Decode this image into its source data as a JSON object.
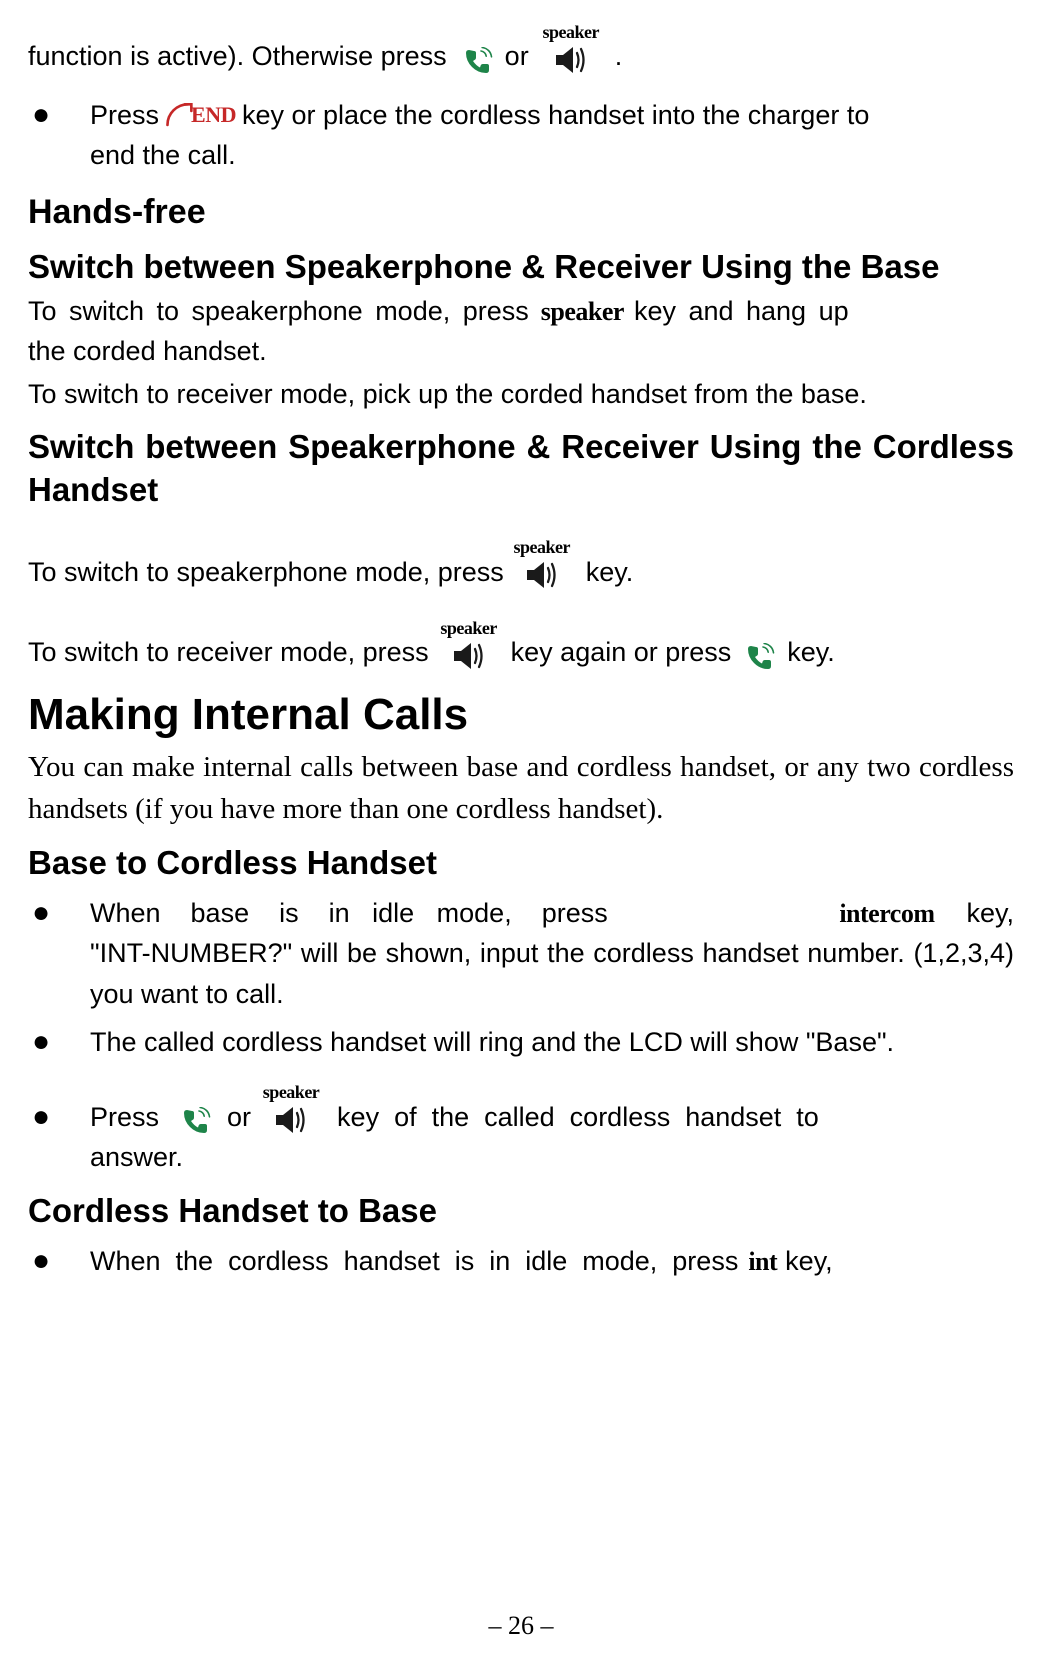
{
  "line1_a": "function is active). Otherwise press",
  "line1_b": "or",
  "line1_c": ".",
  "speaker_label": "speaker",
  "bullet1_a": "Press",
  "end_label": "END",
  "bullet1_b": "key or place the cordless handset into the charger to",
  "bullet1_c": "end the call.",
  "h_handsfree": "Hands-free",
  "h_switch_base": "Switch between Speakerphone & Receiver Using the Base",
  "p1_a": "To switch to speakerphone mode, press",
  "p1_b": "key and hang up",
  "p1_c": "the corded handset.",
  "p2": "To switch to receiver mode, pick up the corded handset from the base.",
  "h_switch_cordless": "Switch between Speakerphone & Receiver Using the Cordless Handset",
  "p3_a": "To switch to speakerphone mode, press",
  "p3_b": "key.",
  "p4_a": "To switch to receiver mode, press",
  "p4_b": "key again or press",
  "p4_c": "key.",
  "h_making": "Making Internal Calls",
  "p5": "You can make internal calls between base and cordless handset, or any two cordless handsets (if you have more than one cordless handset).",
  "h_b2c": "Base to Cordless Handset",
  "b2_a": "When    base    is    in   idle   mode,    press",
  "intercom_label": "intercom",
  "b2_b": "key,",
  "b2_c": "\"INT-NUMBER?\" will be shown, input the cordless handset number. (1,2,3,4) you want to call.",
  "b3": "The called cordless handset will ring and the LCD will show \"Base\".",
  "b4_a": "Press",
  "b4_b": "or",
  "b4_c": "key  of  the  called  cordless  handset  to",
  "b4_d": "answer.",
  "h_c2b": "Cordless Handset to Base",
  "b5_a": "When  the  cordless  handset  is  in  idle  mode,  press",
  "int_label": "int",
  "b5_b": "key,",
  "page_num": "– 26 –"
}
